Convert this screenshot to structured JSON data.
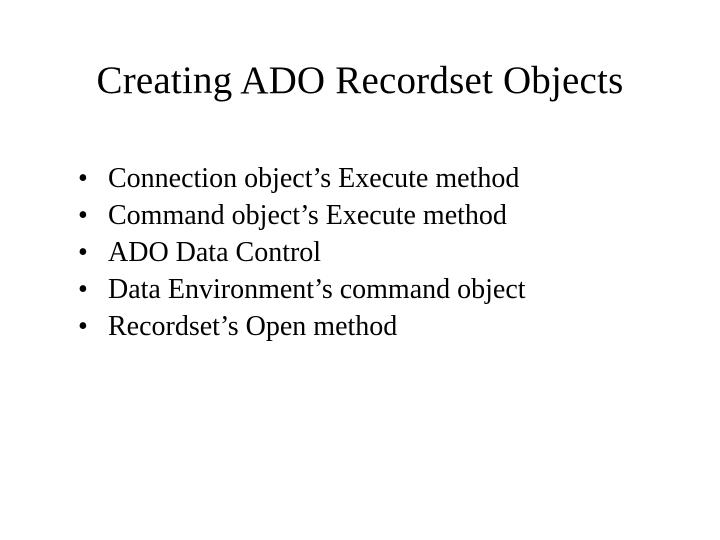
{
  "slide": {
    "title": "Creating ADO Recordset Objects",
    "bullets": [
      "Connection object’s Execute method",
      "Command object’s Execute method",
      "ADO Data Control",
      "Data Environment’s command object",
      "Recordset’s Open method"
    ]
  }
}
